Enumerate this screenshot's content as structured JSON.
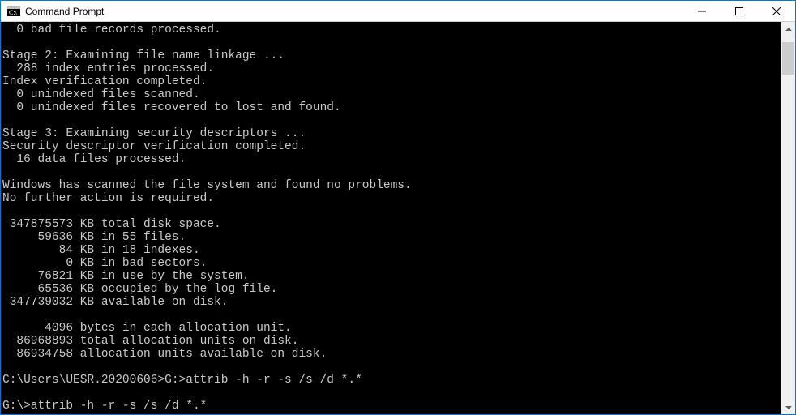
{
  "window": {
    "title": "Command Prompt"
  },
  "terminal": {
    "lines": "  0 bad file records processed.\n\nStage 2: Examining file name linkage ...\n  288 index entries processed.\nIndex verification completed.\n  0 unindexed files scanned.\n  0 unindexed files recovered to lost and found.\n\nStage 3: Examining security descriptors ...\nSecurity descriptor verification completed.\n  16 data files processed.\n\nWindows has scanned the file system and found no problems.\nNo further action is required.\n\n 347875573 KB total disk space.\n     59636 KB in 55 files.\n        84 KB in 18 indexes.\n         0 KB in bad sectors.\n     76821 KB in use by the system.\n     65536 KB occupied by the log file.\n 347739032 KB available on disk.\n\n      4096 bytes in each allocation unit.\n  86968893 total allocation units on disk.\n  86934758 allocation units available on disk.\n\nC:\\Users\\UESR.20200606>G:>attrib -h -r -s /s /d *.*\n\nG:\\>attrib -h -r -s /s /d *.*"
  }
}
